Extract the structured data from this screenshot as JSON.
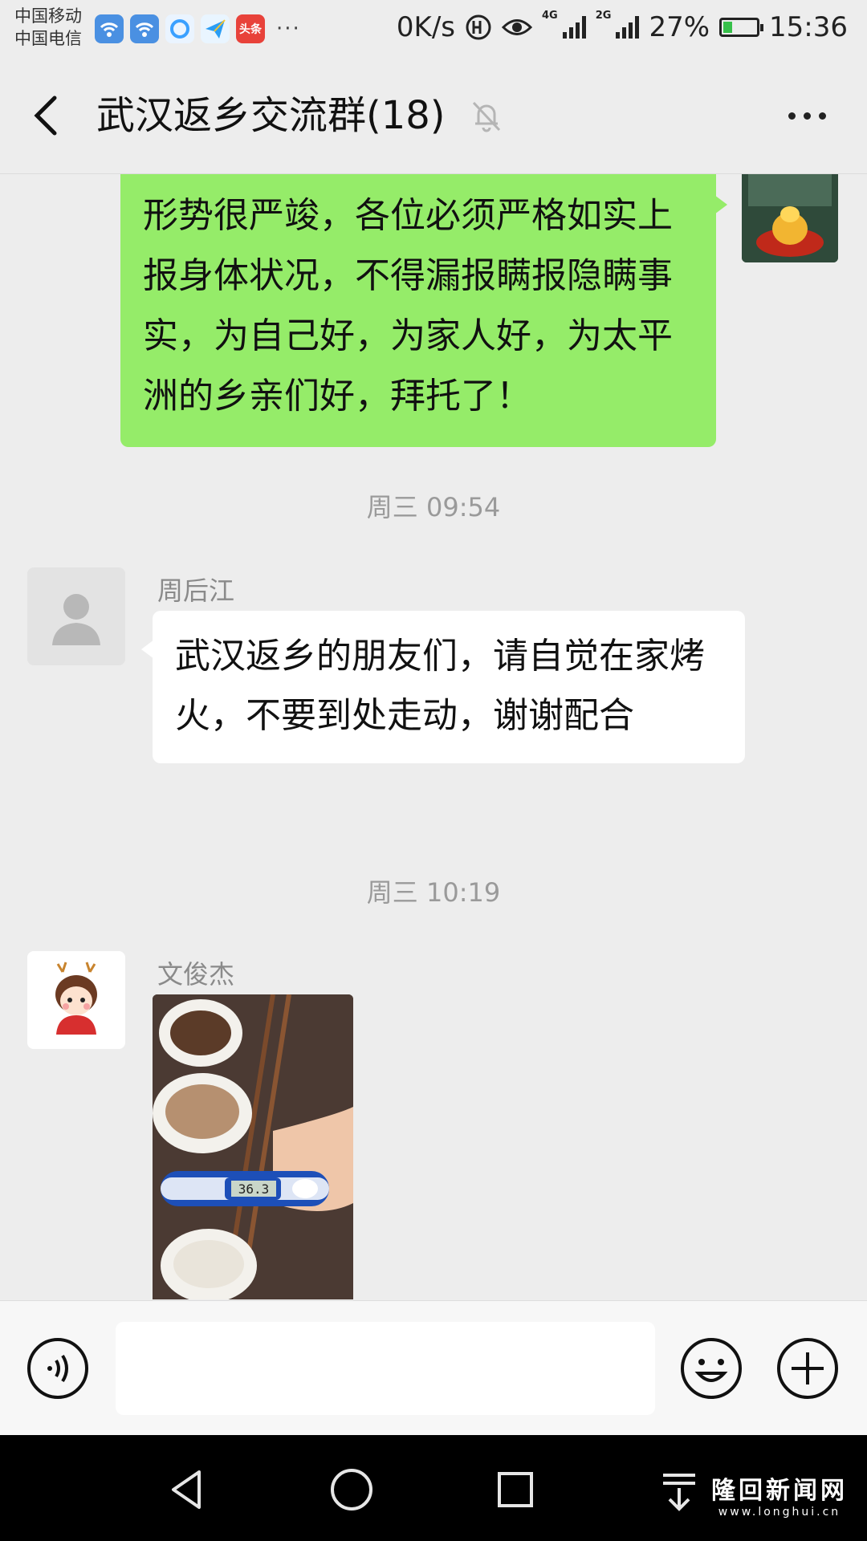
{
  "status_bar": {
    "carrier_1": "中国移动",
    "carrier_2": "中国电信",
    "app_icon_news_label": "头条",
    "more_indicator": "···",
    "net_speed": "0K/s",
    "network_tag_1": "4G",
    "network_tag_2": "2G",
    "battery_percent": "27%",
    "battery_level": 0.27,
    "time": "15:36",
    "icons": [
      "wifi-hotspot-icon",
      "wifi-hotspot-icon",
      "browser-icon",
      "paper-plane-icon",
      "news-app-icon",
      "hd-call-icon",
      "eye-icon",
      "signal-icon",
      "signal-icon",
      "battery-charging-icon"
    ]
  },
  "header": {
    "back_icon": "chevron-left-icon",
    "title": "武汉返乡交流群(18)",
    "mute_icon": "bell-off-icon",
    "more_icon": "more-dots-icon"
  },
  "messages": [
    {
      "type": "outgoing-text",
      "text": "形势很严竣，各位必须严格如实上报身体状况，不得漏报瞒报隐瞒事实，为自己好，为家人好，为太平洲的乡亲们好，拜托了！"
    },
    {
      "type": "timestamp",
      "text": "周三 09:54"
    },
    {
      "type": "incoming-text",
      "sender": "周后江",
      "text": "武汉返乡的朋友们，请自觉在家烤火，不要到处走动，谢谢配合"
    },
    {
      "type": "timestamp",
      "text": "周三 10:19"
    },
    {
      "type": "incoming-image",
      "sender": "文俊杰",
      "thermometer_reading": "36.3"
    }
  ],
  "input_bar": {
    "placeholder": "",
    "icons": [
      "voice-icon",
      "emoji-icon",
      "plus-icon"
    ]
  },
  "nav_bar": {
    "icons": [
      "back-triangle-icon",
      "home-circle-icon",
      "recent-square-icon",
      "notification-pull-icon"
    ],
    "watermark_main": "隆回新闻网",
    "watermark_sub": "www.longhui.cn"
  },
  "colors": {
    "background": "#ededed",
    "outgoing_bubble": "#95ec69",
    "incoming_bubble": "#ffffff",
    "timestamp_text": "#9a9a9a",
    "sender_text": "#8a8a8a",
    "nav_bar": "#000000"
  }
}
